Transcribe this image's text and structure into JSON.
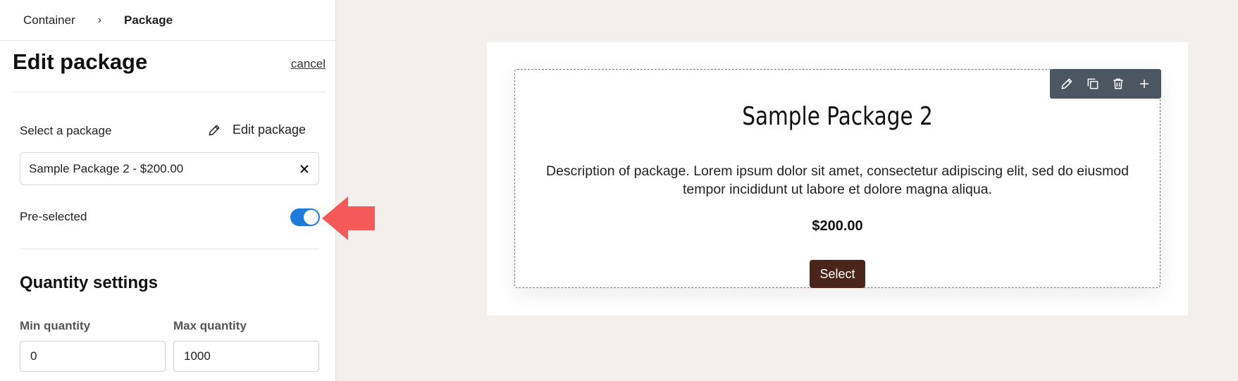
{
  "breadcrumb": {
    "parent": "Container",
    "separator": "›",
    "current": "Package"
  },
  "sidebar": {
    "title": "Edit package",
    "cancel": "cancel",
    "select_label": "Select a package",
    "edit_package_label": "Edit package",
    "selected_package": "Sample Package 2 - $200.00",
    "preselected_label": "Pre-selected",
    "preselected": true,
    "quantity_title": "Quantity settings",
    "min_label": "Min quantity",
    "max_label": "Max quantity",
    "min_value": "0",
    "max_value": "1000"
  },
  "card": {
    "title": "Sample Package 2",
    "description": "Description of package. Lorem ipsum dolor sit amet, consectetur adipiscing elit, sed do eiusmod tempor incididunt ut labore et dolore magna aliqua.",
    "price": "$200.00",
    "button": "Select"
  },
  "toolbar": {
    "icons": [
      "pencil-icon",
      "copy-icon",
      "trash-icon",
      "plus-icon"
    ]
  },
  "colors": {
    "toggle": "#1e7bd9",
    "arrow": "#f55a5a",
    "select_button": "#4a2519",
    "toolbar": "#4b5661"
  }
}
